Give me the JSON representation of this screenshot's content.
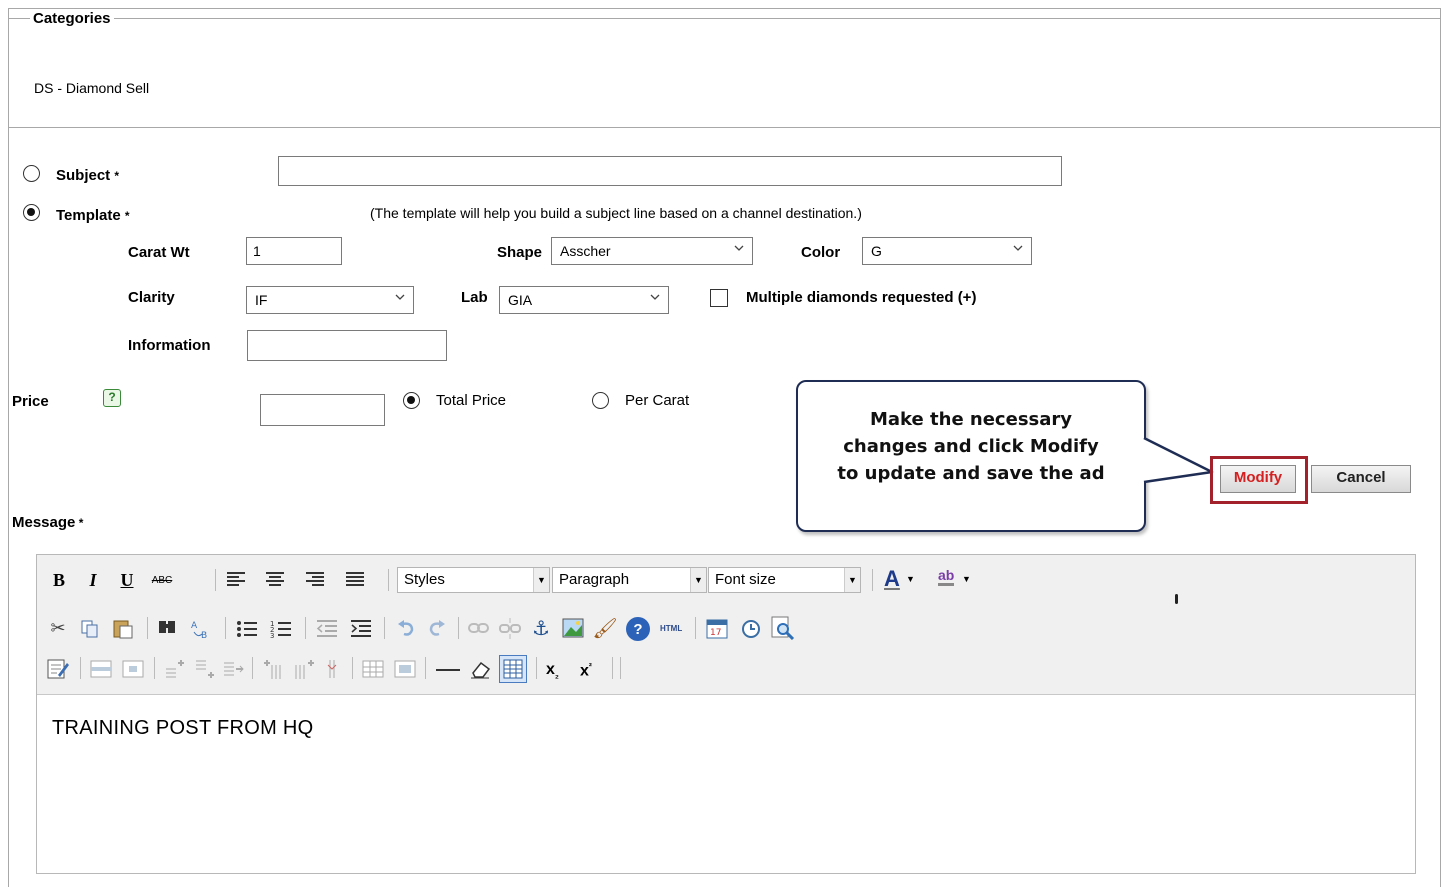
{
  "categories": {
    "legend": "Categories",
    "value": "DS - Diamond Sell"
  },
  "subject": {
    "label": "Subject",
    "required_mark": "*",
    "value": ""
  },
  "template": {
    "label": "Template",
    "required_mark": "*",
    "hint": "(The template will help you build a subject line based on a channel destination.)",
    "carat_label": "Carat Wt",
    "carat_value": "1",
    "shape_label": "Shape",
    "shape_value": "Asscher",
    "color_label": "Color",
    "color_value": "G",
    "clarity_label": "Clarity",
    "clarity_value": "IF",
    "lab_label": "Lab",
    "lab_value": "GIA",
    "multiple_label": "Multiple diamonds requested (+)",
    "information_label": "Information",
    "information_value": ""
  },
  "price": {
    "label": "Price",
    "help_icon": "?",
    "value": "",
    "total_label": "Total Price",
    "per_carat_label": "Per Carat",
    "selected": "Total Price"
  },
  "callout": {
    "line1": "Make the necessary",
    "line2": "changes and click Modify",
    "line3": "to update and save the ad"
  },
  "actions": {
    "modify_label": "Modify",
    "cancel_label": "Cancel"
  },
  "message": {
    "label": "Message",
    "required_mark": "*",
    "toolbar": {
      "bold": "B",
      "italic": "I",
      "underline": "U",
      "strike": "ABC",
      "styles": "Styles",
      "paragraph": "Paragraph",
      "font_size": "Font size",
      "font_color": "A",
      "highlight": "ab",
      "html": "HTML"
    },
    "content": "TRAINING POST FROM HQ"
  },
  "colors": {
    "callout_border": "#1f2d55",
    "modify_frame": "#a3212b",
    "modify_text": "#d42020",
    "help_icon": "#3a8a3a"
  }
}
